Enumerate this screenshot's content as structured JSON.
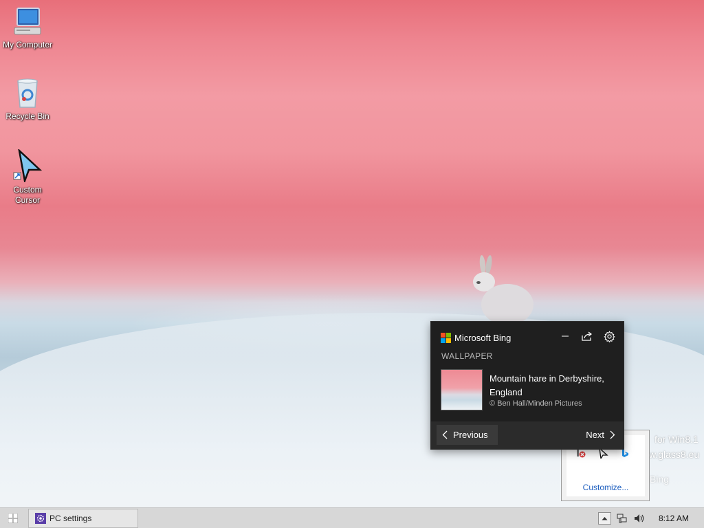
{
  "desktop": {
    "icons": [
      {
        "label": "My Computer",
        "icon": "computer-icon"
      },
      {
        "label": "Recycle Bin",
        "icon": "recycle-bin-icon"
      },
      {
        "label": "Custom\nCursor",
        "icon": "cursor-shortcut-icon"
      }
    ],
    "watermark": {
      "line1": "for Win8.1",
      "line2": "w.glass8.eu",
      "line3": "Bing"
    }
  },
  "bing_flyout": {
    "brand": "Microsoft Bing",
    "section": "WALLPAPER",
    "wallpaper_title": "Mountain hare in Derbyshire, England",
    "credit": "© Ben Hall/Minden Pictures",
    "previous_label": "Previous",
    "next_label": "Next",
    "logo_colors": [
      "#f25022",
      "#7fba00",
      "#00a4ef",
      "#ffb900"
    ]
  },
  "tray_popup": {
    "customize_label": "Customize..."
  },
  "taskbar": {
    "task_label": "PC settings",
    "clock": "8:12 AM"
  },
  "colors": {
    "flyout_bg": "#1f1f1f",
    "taskbar_bg": "#d7d7d7",
    "link": "#1e5fbf"
  }
}
